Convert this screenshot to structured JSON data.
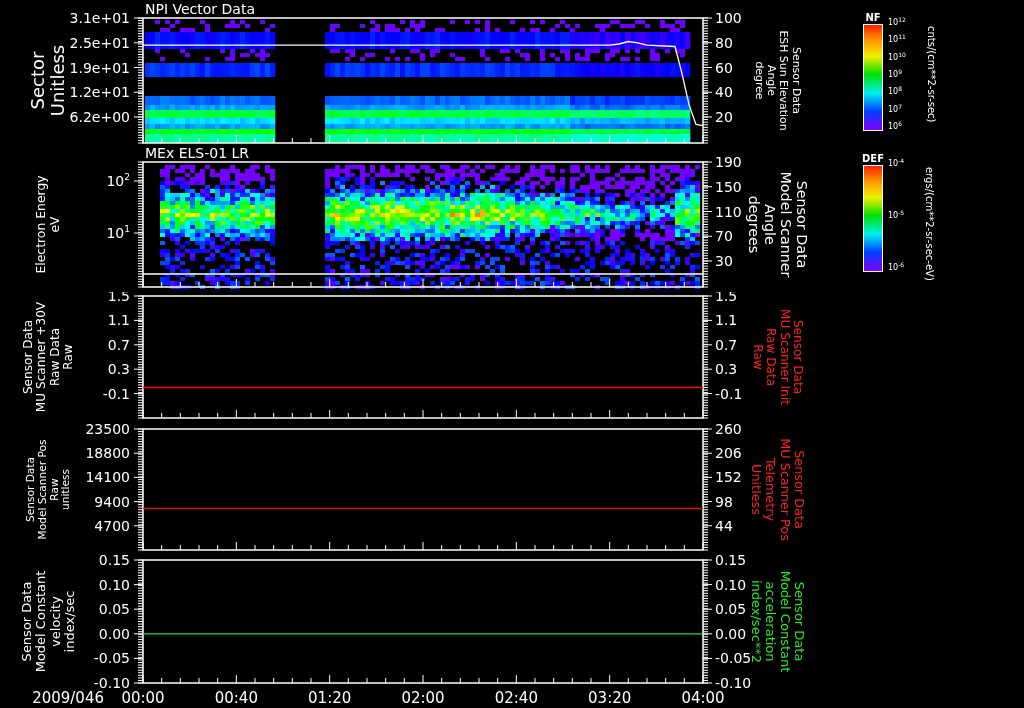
{
  "panels": [
    {
      "title": "NPI Vector Data",
      "kind": "spectrogram",
      "left_label": [
        "Sector",
        "Unitless"
      ],
      "left_ticks": [
        "3.1e+01",
        "2.5e+01",
        "1.9e+01",
        "1.2e+01",
        "6.2e+00"
      ],
      "right_label": {
        "lines": [
          "Sensor Data",
          "ESH Sun Elevation",
          "Angle",
          "degree"
        ],
        "color": "#ffffff"
      },
      "chart_data": {
        "type": "line",
        "x": [
          0,
          200,
          204,
          208,
          212,
          216,
          228,
          231,
          234,
          237,
          240
        ],
        "xlim": [
          0,
          240
        ],
        "ylim": [
          -1,
          100
        ],
        "yticks": [
          100,
          80,
          60,
          40,
          20
        ],
        "series": [
          {
            "color": "#ffffff",
            "values": [
              78,
              78,
              79,
              81,
              80,
              78,
              77,
              55,
              30,
              14,
              13
            ]
          }
        ]
      }
    },
    {
      "title": "MEx ELS-01 LR",
      "kind": "spectrogram",
      "left_label": [
        "Electron Energy",
        "eV"
      ],
      "left_ticks": [
        "10$^{2}$",
        "10$^{1}$"
      ],
      "right_label": {
        "lines": [
          "Sensor Data",
          "Model Scanner",
          "Angle",
          "degrees"
        ],
        "color": "#ffffff"
      },
      "chart_data": {
        "type": "line",
        "x": [
          0,
          240
        ],
        "xlim": [
          0,
          240
        ],
        "ylim": [
          -12,
          190
        ],
        "yticks": [
          190,
          150,
          110,
          70,
          30
        ],
        "series": [
          {
            "color": "#ffffff",
            "values": [
              9,
              9
            ]
          }
        ]
      }
    },
    {
      "kind": "line",
      "left_label": [
        "Sensor Data",
        "MU Scanner +30V",
        "Raw Data",
        "Raw"
      ],
      "left_ticks": [
        "1.5",
        "1.1",
        "0.7",
        "0.3",
        "-0.1"
      ],
      "right_label": {
        "lines": [
          "Sensor Data",
          "MU Scanner Init",
          "Raw Data",
          "Raw"
        ],
        "color": "#ff2020"
      },
      "chart_data": {
        "type": "line",
        "x": [
          0,
          240
        ],
        "xlim": [
          0,
          240
        ],
        "ylim": [
          -0.5,
          1.5
        ],
        "yticks": [
          1.5,
          1.1,
          0.7,
          0.3,
          -0.1
        ],
        "series": [
          {
            "color": "#ff0000",
            "values": [
              0,
              0
            ]
          }
        ]
      }
    },
    {
      "kind": "line",
      "left_label": [
        "Sensor Data",
        "Model Scanner Pos",
        "Raw",
        "unitless"
      ],
      "left_ticks": [
        "23500",
        "18800",
        "14100",
        "9400",
        "4700"
      ],
      "right_label": {
        "lines": [
          "Sensor Data",
          "MU Scanner Pos",
          "Telemetry",
          "Unitless"
        ],
        "color": "#ff2020"
      },
      "chart_data": {
        "type": "line",
        "x": [
          0,
          240
        ],
        "xlim": [
          0,
          240
        ],
        "ylim": [
          -10,
          260
        ],
        "yticks": [
          260,
          206,
          152,
          98,
          44
        ],
        "series": [
          {
            "color": "#ff0000",
            "values": [
              83,
              83
            ]
          }
        ]
      }
    },
    {
      "kind": "line",
      "left_label": [
        "Sensor Data",
        "Model Constant",
        "velocity",
        "index/sec"
      ],
      "left_ticks": [
        "0.15",
        "0.10",
        "0.05",
        "0.00",
        "-0.05",
        "-0.10"
      ],
      "right_label": {
        "lines": [
          "Sensor Data",
          "Model Constant",
          "acceleration",
          "index/sec**2"
        ],
        "color": "#22ee22"
      },
      "chart_data": {
        "type": "line",
        "x": [
          0,
          240
        ],
        "xlim": [
          0,
          240
        ],
        "ylim": [
          -0.1,
          0.15
        ],
        "yticks": [
          {
            "value": 0.15,
            "label": "0.15"
          },
          {
            "value": 0.1,
            "label": "0.10"
          },
          {
            "value": 0.05,
            "label": "0.05"
          },
          {
            "value": 0,
            "label": "0.00"
          },
          {
            "value": -0.05,
            "label": "-0.05"
          },
          {
            "value": -0.1,
            "label": "-0.10"
          }
        ],
        "xticks": [
          {
            "value": 0,
            "label": "00:00"
          },
          {
            "value": 40,
            "label": "00:40"
          },
          {
            "value": 80,
            "label": "01:20"
          },
          {
            "value": 120,
            "label": "02:00"
          },
          {
            "value": 160,
            "label": "02:40"
          },
          {
            "value": 200,
            "label": "03:20"
          },
          {
            "value": 240,
            "label": "04:00"
          }
        ],
        "series": [
          {
            "color": "#22dd22",
            "values": [
              0,
              0
            ]
          }
        ]
      }
    }
  ],
  "date_label": "2009/046",
  "color_scales": [
    {
      "title": "NF",
      "ticks": [
        "10$^{12}$",
        "10$^{11}$",
        "10$^{10}$",
        "10$^{9}$",
        "10$^{8}$",
        "10$^{7}$",
        "10$^{6}$"
      ],
      "units": "cnts/(cm**2-sr-sec)"
    },
    {
      "title": "DEF",
      "ticks": [
        "10$^{-4}$",
        "10$^{-5}$",
        "10$^{-6}$"
      ],
      "units": "ergs/(cm**2-sr-sec-eV)"
    }
  ]
}
